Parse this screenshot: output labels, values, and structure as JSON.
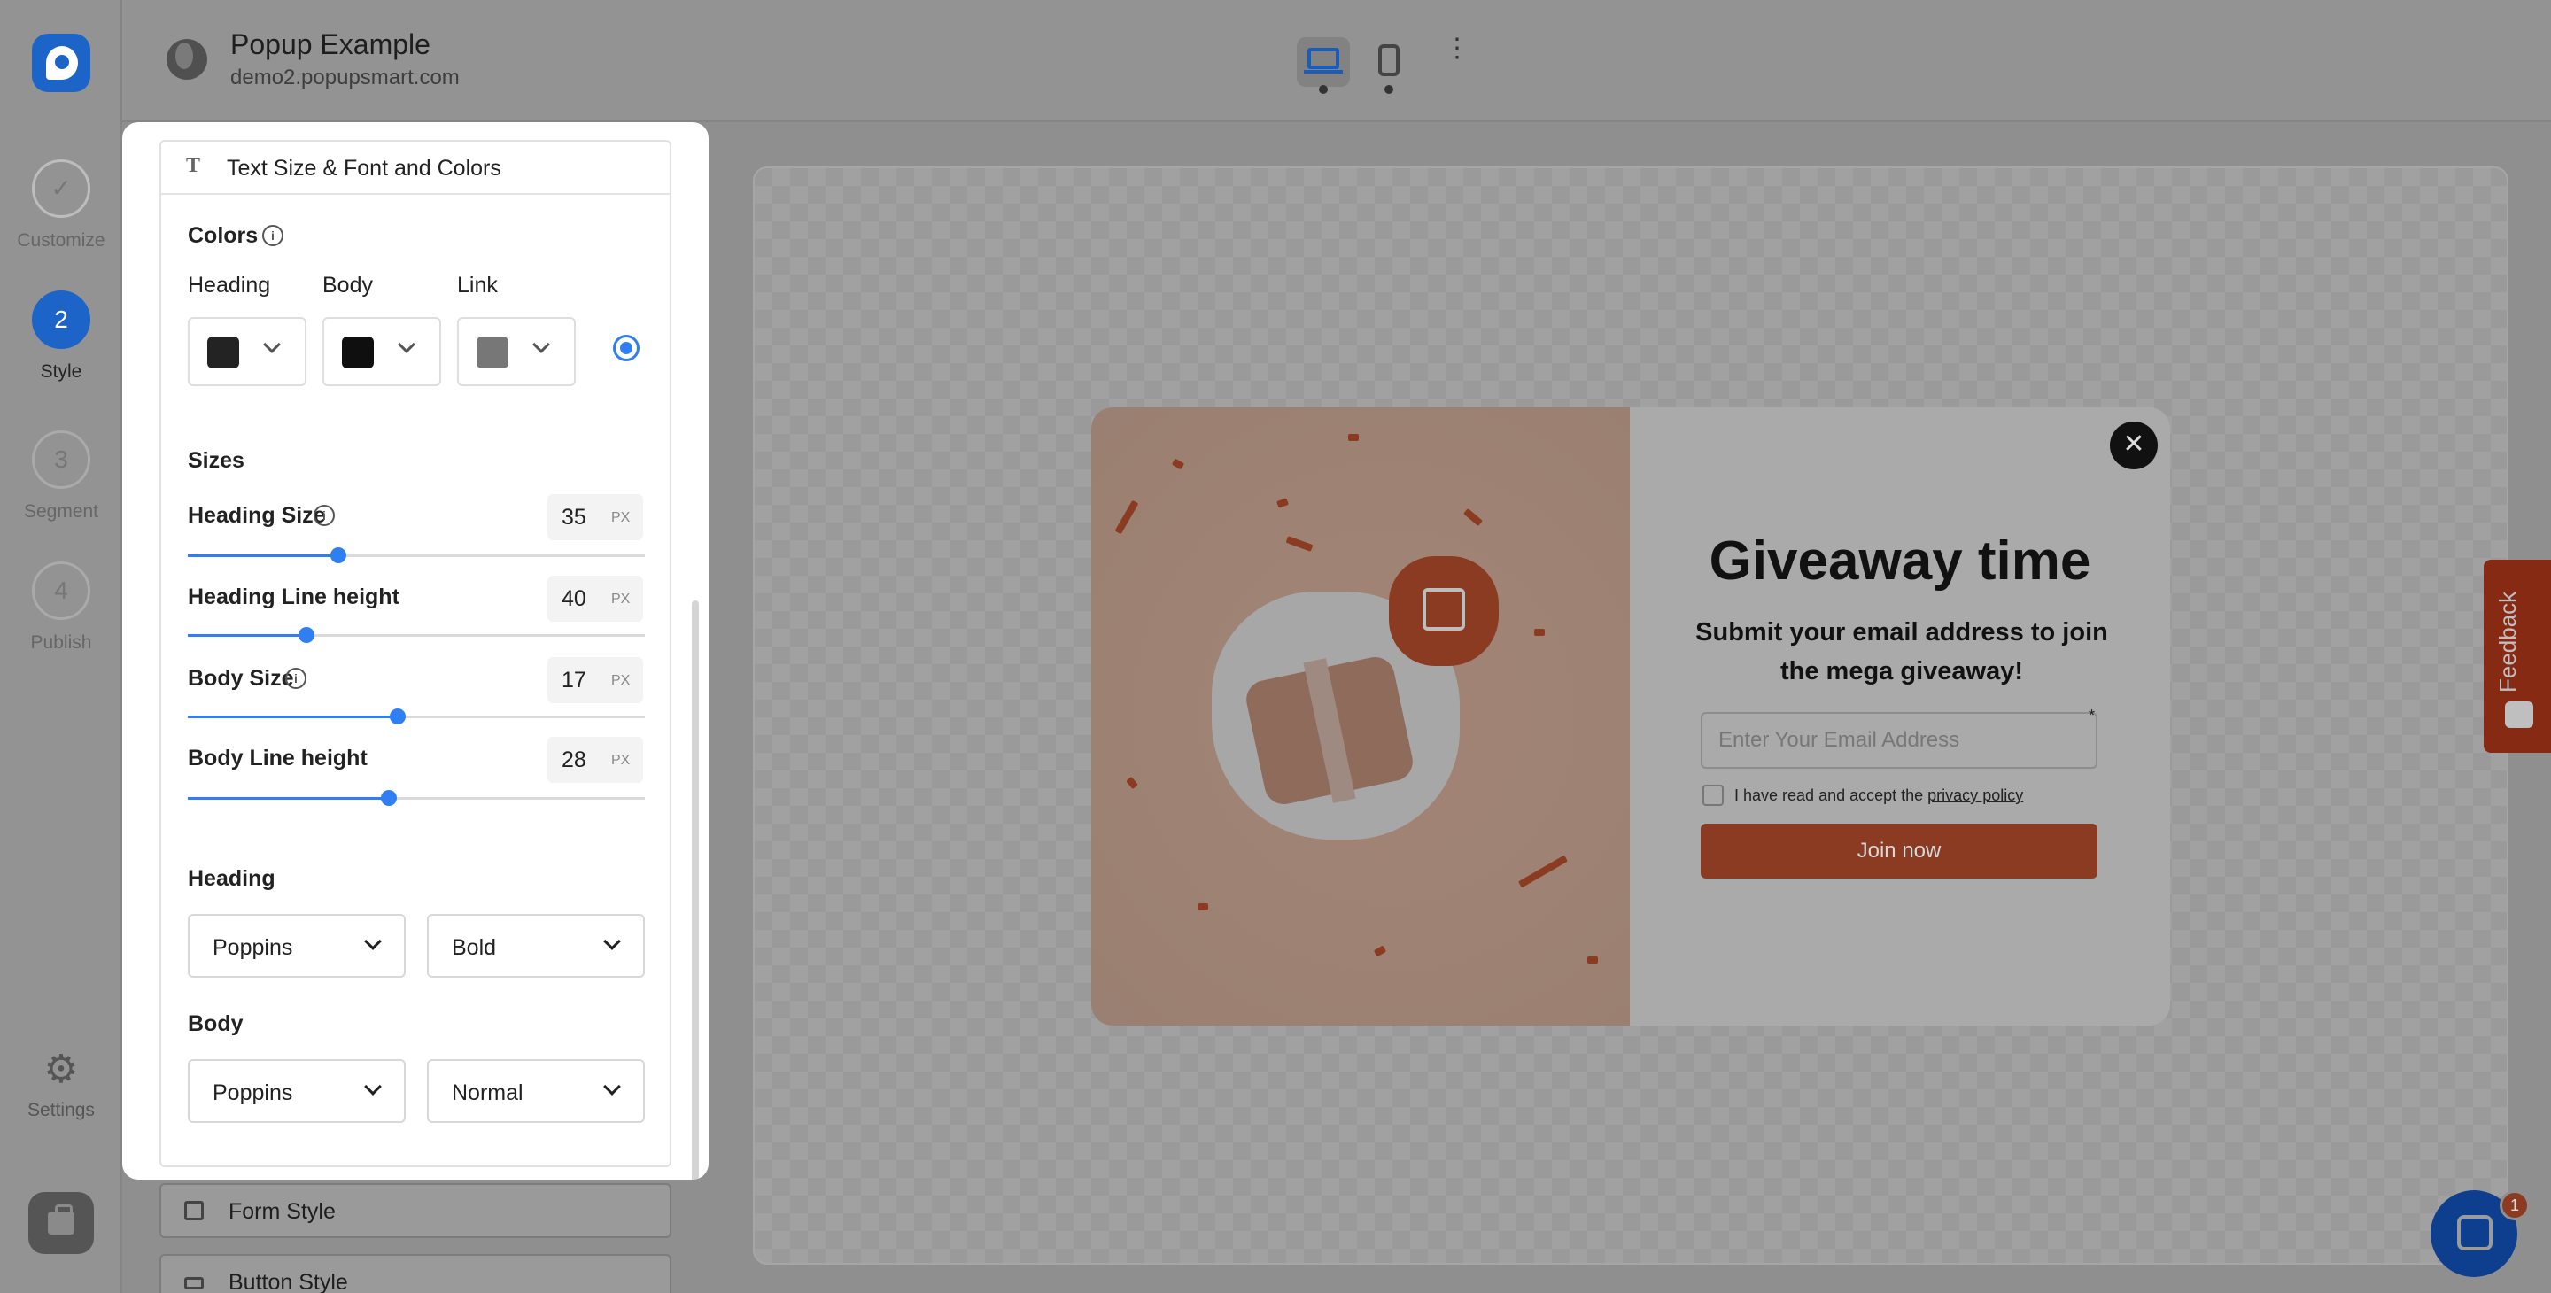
{
  "app": {
    "title": "Popup Example",
    "domain": "demo2.popupsmart.com"
  },
  "steps": [
    {
      "number": "",
      "label": "Customize",
      "state": "done"
    },
    {
      "number": "2",
      "label": "Style",
      "state": "active"
    },
    {
      "number": "3",
      "label": "Segment",
      "state": "pending"
    },
    {
      "number": "4",
      "label": "Publish",
      "state": "pending"
    }
  ],
  "settings_label": "Settings",
  "panel": {
    "section_title": "Text Size & Font and Colors",
    "colors_label": "Colors",
    "color_fields": [
      {
        "label": "Heading",
        "value": "#232323"
      },
      {
        "label": "Body",
        "value": "#0f0f0f"
      },
      {
        "label": "Link",
        "value": "#777777"
      }
    ],
    "sizes_label": "Sizes",
    "sizes": [
      {
        "label": "Heading Size",
        "value": "35",
        "unit": "PX",
        "fraction": 0.33
      },
      {
        "label": "Heading Line height",
        "value": "40",
        "unit": "PX",
        "fraction": 0.26
      },
      {
        "label": "Body Size",
        "value": "17",
        "unit": "PX",
        "fraction": 0.46
      },
      {
        "label": "Body Line height",
        "value": "28",
        "unit": "PX",
        "fraction": 0.44
      }
    ],
    "heading_font_label": "Heading",
    "heading_font": {
      "family": "Poppins",
      "weight": "Bold"
    },
    "body_font_label": "Body",
    "body_font": {
      "family": "Poppins",
      "weight": "Normal"
    },
    "more_sections": [
      "Form Style",
      "Button Style"
    ]
  },
  "popup": {
    "title": "Giveaway time",
    "subtitle": "Submit your email address to join the mega giveaway!",
    "email_placeholder": "Enter Your Email Address",
    "required_marker": "*",
    "consent_prefix": "I have read and accept the",
    "consent_link": "privacy policy",
    "button_label": "Join now",
    "close_glyph": "✕",
    "accent_color": "#c3401d"
  },
  "feedback_label": "Feedback",
  "chat_badge": "1",
  "icons": {
    "done_check": "✓",
    "info": "i",
    "settings_gear": "⚙",
    "kebab": "⋮",
    "text_type": "T"
  }
}
